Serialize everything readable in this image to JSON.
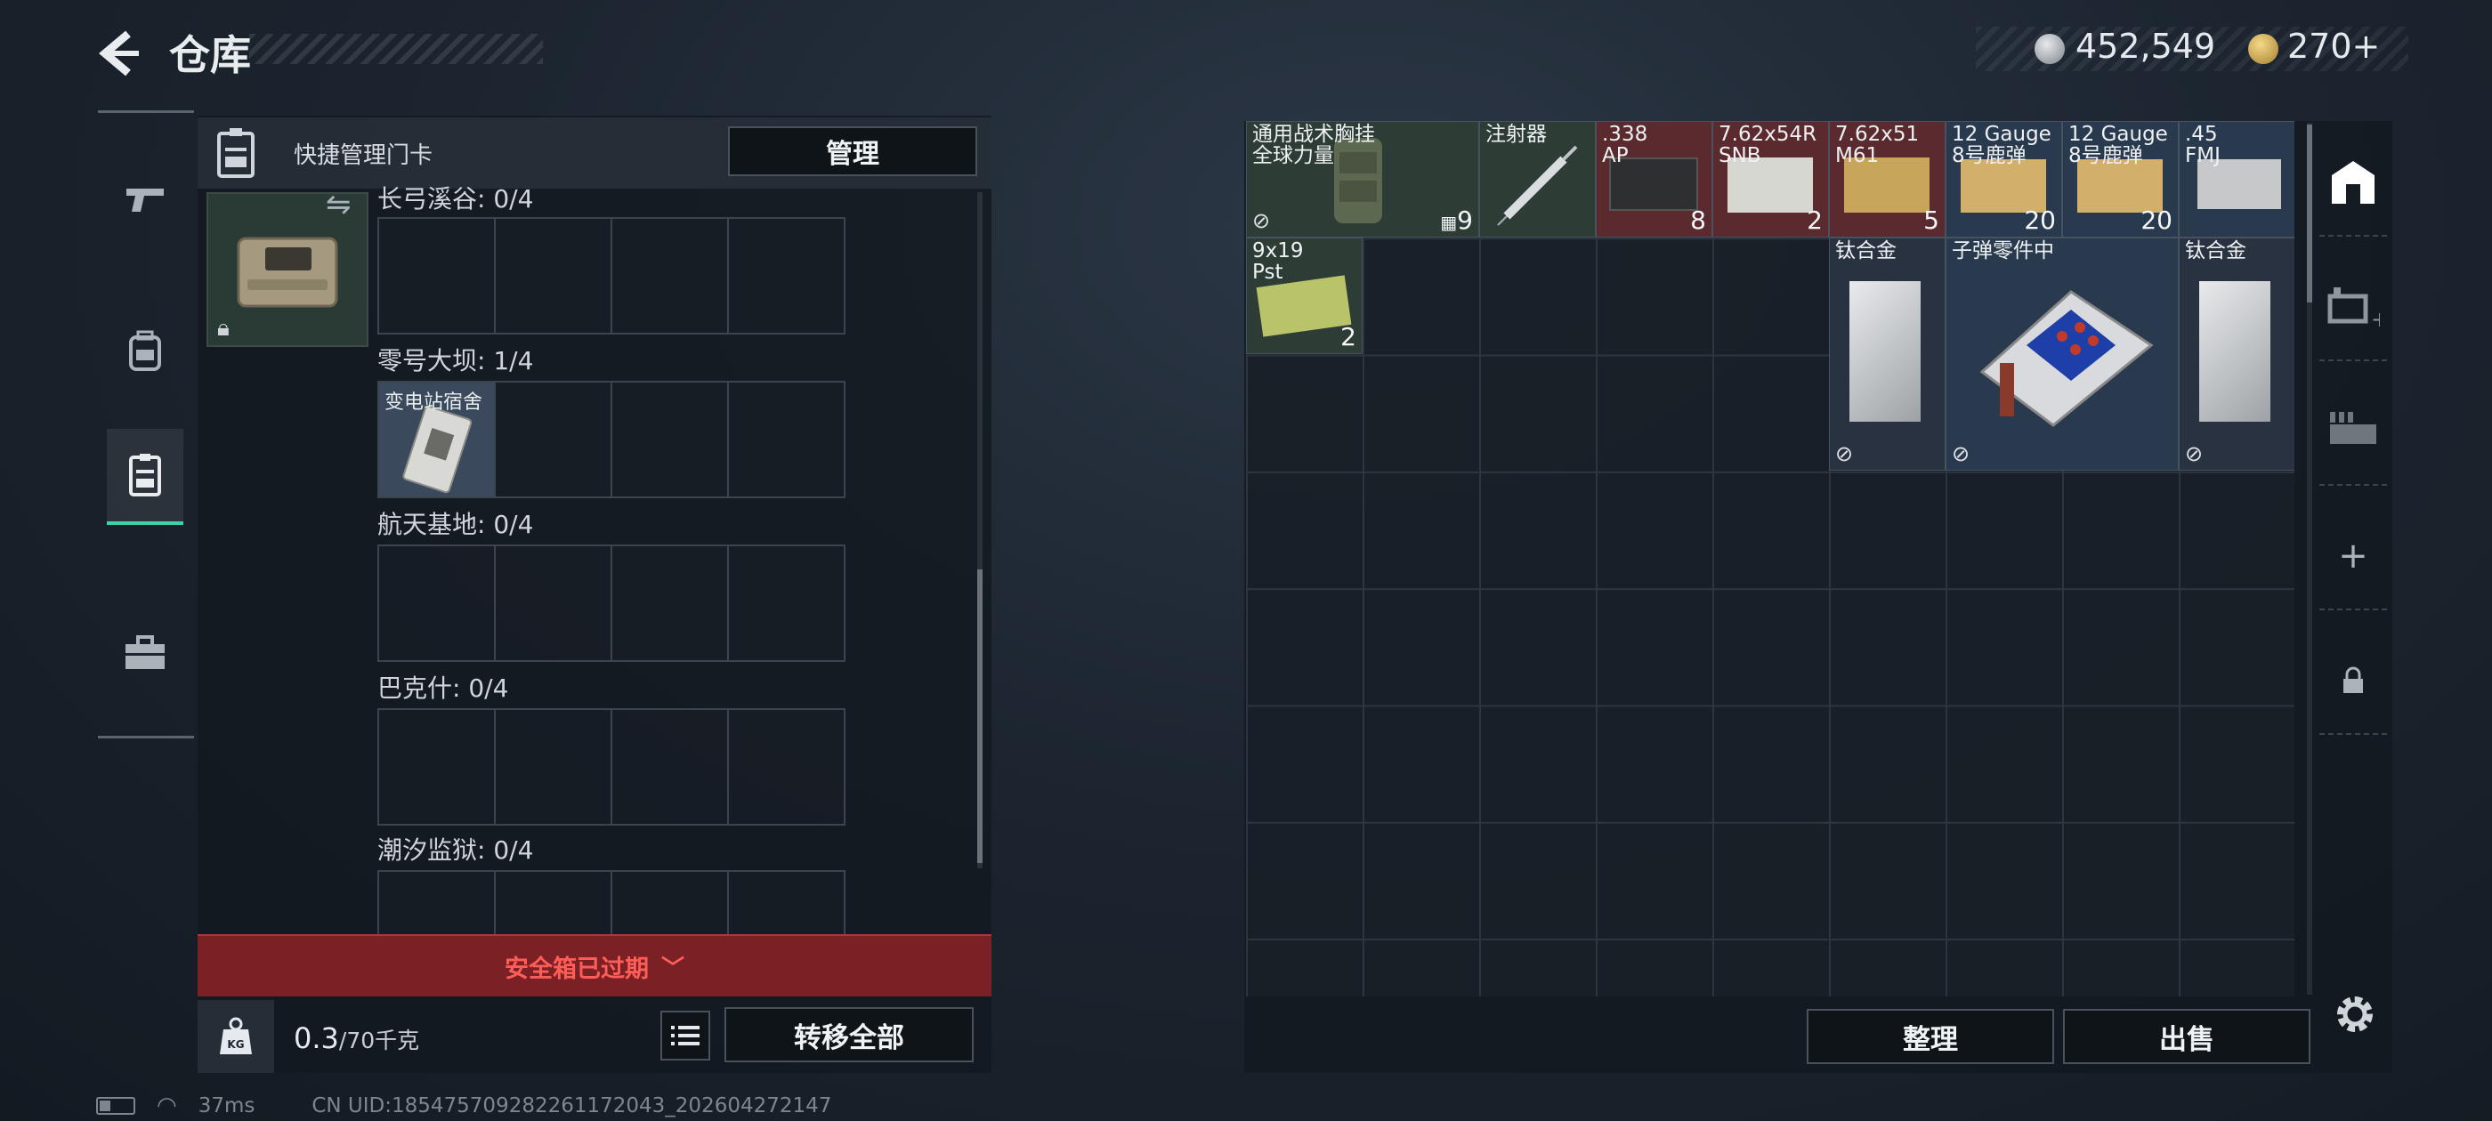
{
  "header": {
    "title": "仓库",
    "money": "452,549",
    "bonds": "270",
    "bonds_plus": "+"
  },
  "tabs": [
    {
      "icon": "pistol-icon"
    },
    {
      "icon": "backpack-icon"
    },
    {
      "icon": "keycard-icon",
      "active": true
    },
    {
      "icon": "briefcase-icon"
    }
  ],
  "left_panel": {
    "header_label": "快捷管理门卡",
    "manage_label": "管理",
    "maps": [
      {
        "label": "长弓溪谷: 0/4"
      },
      {
        "label": "零号大坝: 1/4",
        "card": "变电站宿舍"
      },
      {
        "label": "航天基地: 0/4"
      },
      {
        "label": "巴克什: 0/4"
      },
      {
        "label": "潮汐监狱: 0/4"
      }
    ],
    "expired_text": "安全箱已过期",
    "weight_value": "0.3",
    "weight_max": "/70千克",
    "weight_icon_text": "KG",
    "transfer_label": "转移全部"
  },
  "stash": {
    "items": [
      {
        "name": "通用战术胸挂\n全球力量",
        "qty": "9",
        "bg": "green",
        "nosell": true
      },
      {
        "name": "注射器",
        "qty": "",
        "bg": "green"
      },
      {
        "name": ".338\nAP",
        "qty": "8",
        "bg": "red"
      },
      {
        "name": "7.62x54R\nSNB",
        "qty": "2",
        "bg": "red"
      },
      {
        "name": "7.62x51\nM61",
        "qty": "5",
        "bg": "red"
      },
      {
        "name": "12 Gauge\n8号鹿弹",
        "qty": "20",
        "bg": "blue"
      },
      {
        "name": "12 Gauge\n8号鹿弹",
        "qty": "20",
        "bg": "blue"
      },
      {
        "name": ".45\nFMJ",
        "qty": "",
        "bg": "blue"
      },
      {
        "name": "9x19\nPst",
        "qty": "2",
        "bg": "green"
      },
      {
        "name": "钛合金",
        "qty": "",
        "bg": "dark",
        "nosell": true
      },
      {
        "name": "子弹零件中",
        "qty": "",
        "bg": "dark",
        "nosell": true
      },
      {
        "name": "钛合金",
        "qty": "",
        "bg": "dark",
        "nosell": true
      }
    ],
    "sort_label": "整理",
    "sell_label": "出售"
  },
  "side_tabs": [
    {
      "icon": "stash-home-icon",
      "active": true
    },
    {
      "icon": "add-stash-icon"
    },
    {
      "icon": "expand-stash-icon"
    },
    {
      "icon": "plus-icon",
      "text": "+"
    },
    {
      "icon": "lock-icon"
    }
  ],
  "status": {
    "ping": "37ms",
    "uid": "CN UID:1854757092822611720​43_202604272147"
  },
  "colors": {
    "accent": "#3fd1a8",
    "expired_red": "#ff5d57",
    "item_green": "#2e3c36",
    "item_red": "#5a2a2e",
    "item_blue": "#2a3a4e"
  }
}
